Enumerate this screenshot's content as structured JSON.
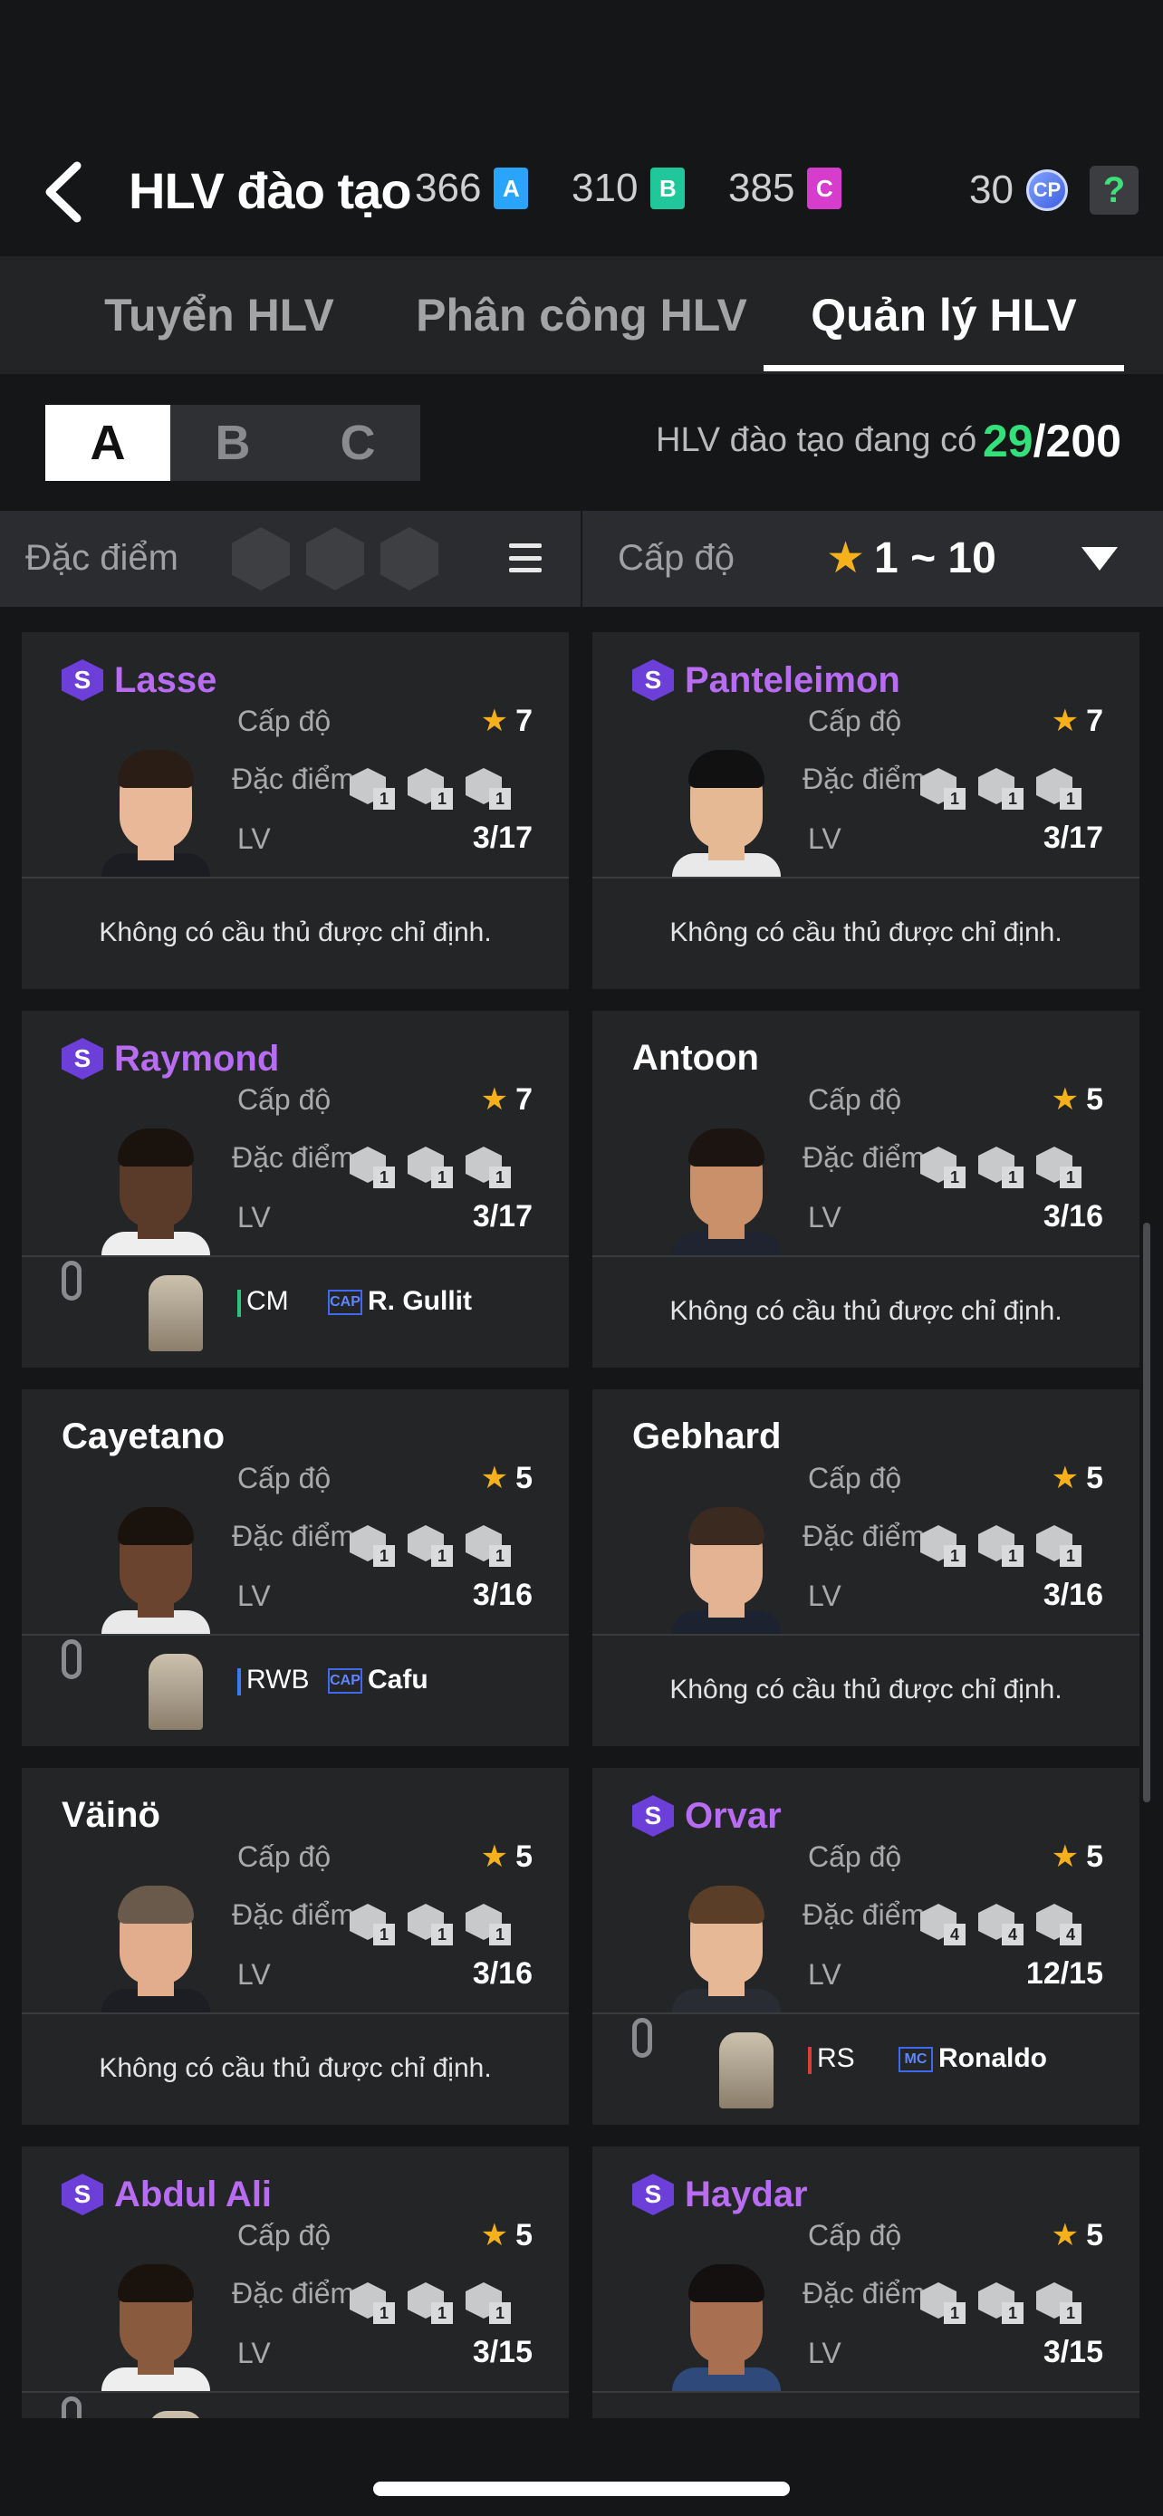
{
  "header": {
    "title": "HLV đào tạo",
    "currencies": [
      {
        "value": "366",
        "label": "A",
        "color": "#2aa5ff"
      },
      {
        "value": "310",
        "label": "B",
        "color": "#1fc79a"
      },
      {
        "value": "385",
        "label": "C",
        "color": "#d63dcc"
      }
    ],
    "cp_value": "30",
    "cp_label": "CP",
    "help_label": "?"
  },
  "tabs": [
    {
      "label": "Tuyển HLV",
      "active": false
    },
    {
      "label": "Phân công HLV",
      "active": false
    },
    {
      "label": "Quản lý HLV",
      "active": true
    }
  ],
  "groups": [
    {
      "label": "A",
      "active": true
    },
    {
      "label": "B",
      "active": false
    },
    {
      "label": "C",
      "active": false
    }
  ],
  "coach_count": {
    "label": "HLV đào tạo đang có",
    "current": "29",
    "total": "/200"
  },
  "filter": {
    "trait_label": "Đặc điểm c",
    "level_label": "Cấp độ",
    "level_star": "★",
    "level_range": "1 ~ 10"
  },
  "labels": {
    "level": "Cấp độ",
    "trait": "Đặc điểm",
    "lv": "LV",
    "no_player": "Không có cầu thủ được chỉ định.",
    "star": "★"
  },
  "coaches": [
    {
      "name": "Lasse",
      "special": true,
      "level": "7",
      "lv": "3/17",
      "traits": [
        "1",
        "1",
        "1"
      ],
      "assigned": null,
      "skin": "#e8b898",
      "hair": "#2a1d16",
      "shirt": "#1b1d22"
    },
    {
      "name": "Panteleimon",
      "special": true,
      "level": "7",
      "lv": "3/17",
      "traits": [
        "1",
        "1",
        "1"
      ],
      "assigned": null,
      "skin": "#e6b995",
      "hair": "#111111",
      "shirt": "#e9e9e9"
    },
    {
      "name": "Raymond",
      "special": true,
      "level": "7",
      "lv": "3/17",
      "traits": [
        "1",
        "1",
        "1"
      ],
      "assigned": {
        "pos": "CM",
        "pos_color": "#2ec27e",
        "tag": "CAP",
        "player": "R. Gullit"
      },
      "skin": "#5a3a28",
      "hair": "#1a120d",
      "shirt": "#eeeeee"
    },
    {
      "name": "Antoon",
      "special": false,
      "level": "5",
      "lv": "3/16",
      "traits": [
        "1",
        "1",
        "1"
      ],
      "assigned": null,
      "skin": "#c9906a",
      "hair": "#1c1410",
      "shirt": "#1f2430"
    },
    {
      "name": "Cayetano",
      "special": false,
      "level": "5",
      "lv": "3/16",
      "traits": [
        "1",
        "1",
        "1"
      ],
      "assigned": {
        "pos": "RWB",
        "pos_color": "#3d7bf2",
        "tag": "CAP",
        "player": "Cafu"
      },
      "skin": "#6b4430",
      "hair": "#1a120d",
      "shirt": "#e9e9e9"
    },
    {
      "name": "Gebhard",
      "special": false,
      "level": "5",
      "lv": "3/16",
      "traits": [
        "1",
        "1",
        "1"
      ],
      "assigned": null,
      "skin": "#e4b394",
      "hair": "#3a2a20",
      "shirt": "#1c2230"
    },
    {
      "name": "Väinö",
      "special": false,
      "level": "5",
      "lv": "3/16",
      "traits": [
        "1",
        "1",
        "1"
      ],
      "assigned": null,
      "skin": "#e2ad8c",
      "hair": "#6a5a4c",
      "shirt": "#1c1e24"
    },
    {
      "name": "Orvar",
      "special": true,
      "level": "5",
      "lv": "12/15",
      "traits": [
        "4",
        "4",
        "4"
      ],
      "assigned": {
        "pos": "RS",
        "pos_color": "#e03b3b",
        "tag": "MC",
        "player": "Ronaldo"
      },
      "skin": "#e7b896",
      "hair": "#5a3e28",
      "shirt": "#2a2c33"
    },
    {
      "name": "Abdul Ali",
      "special": true,
      "level": "5",
      "lv": "3/15",
      "traits": [
        "1",
        "1",
        "1"
      ],
      "assigned": {
        "pos": "",
        "pos_color": "#888888",
        "tag": "",
        "player": ""
      },
      "skin": "#8a5a3e",
      "hair": "#1a120d",
      "shirt": "#eeeeee"
    },
    {
      "name": "Haydar",
      "special": true,
      "level": "5",
      "lv": "3/15",
      "traits": [
        "1",
        "1",
        "1"
      ],
      "assigned": null,
      "skin": "#a87050",
      "hair": "#151010",
      "shirt": "#2f4a7a"
    }
  ]
}
